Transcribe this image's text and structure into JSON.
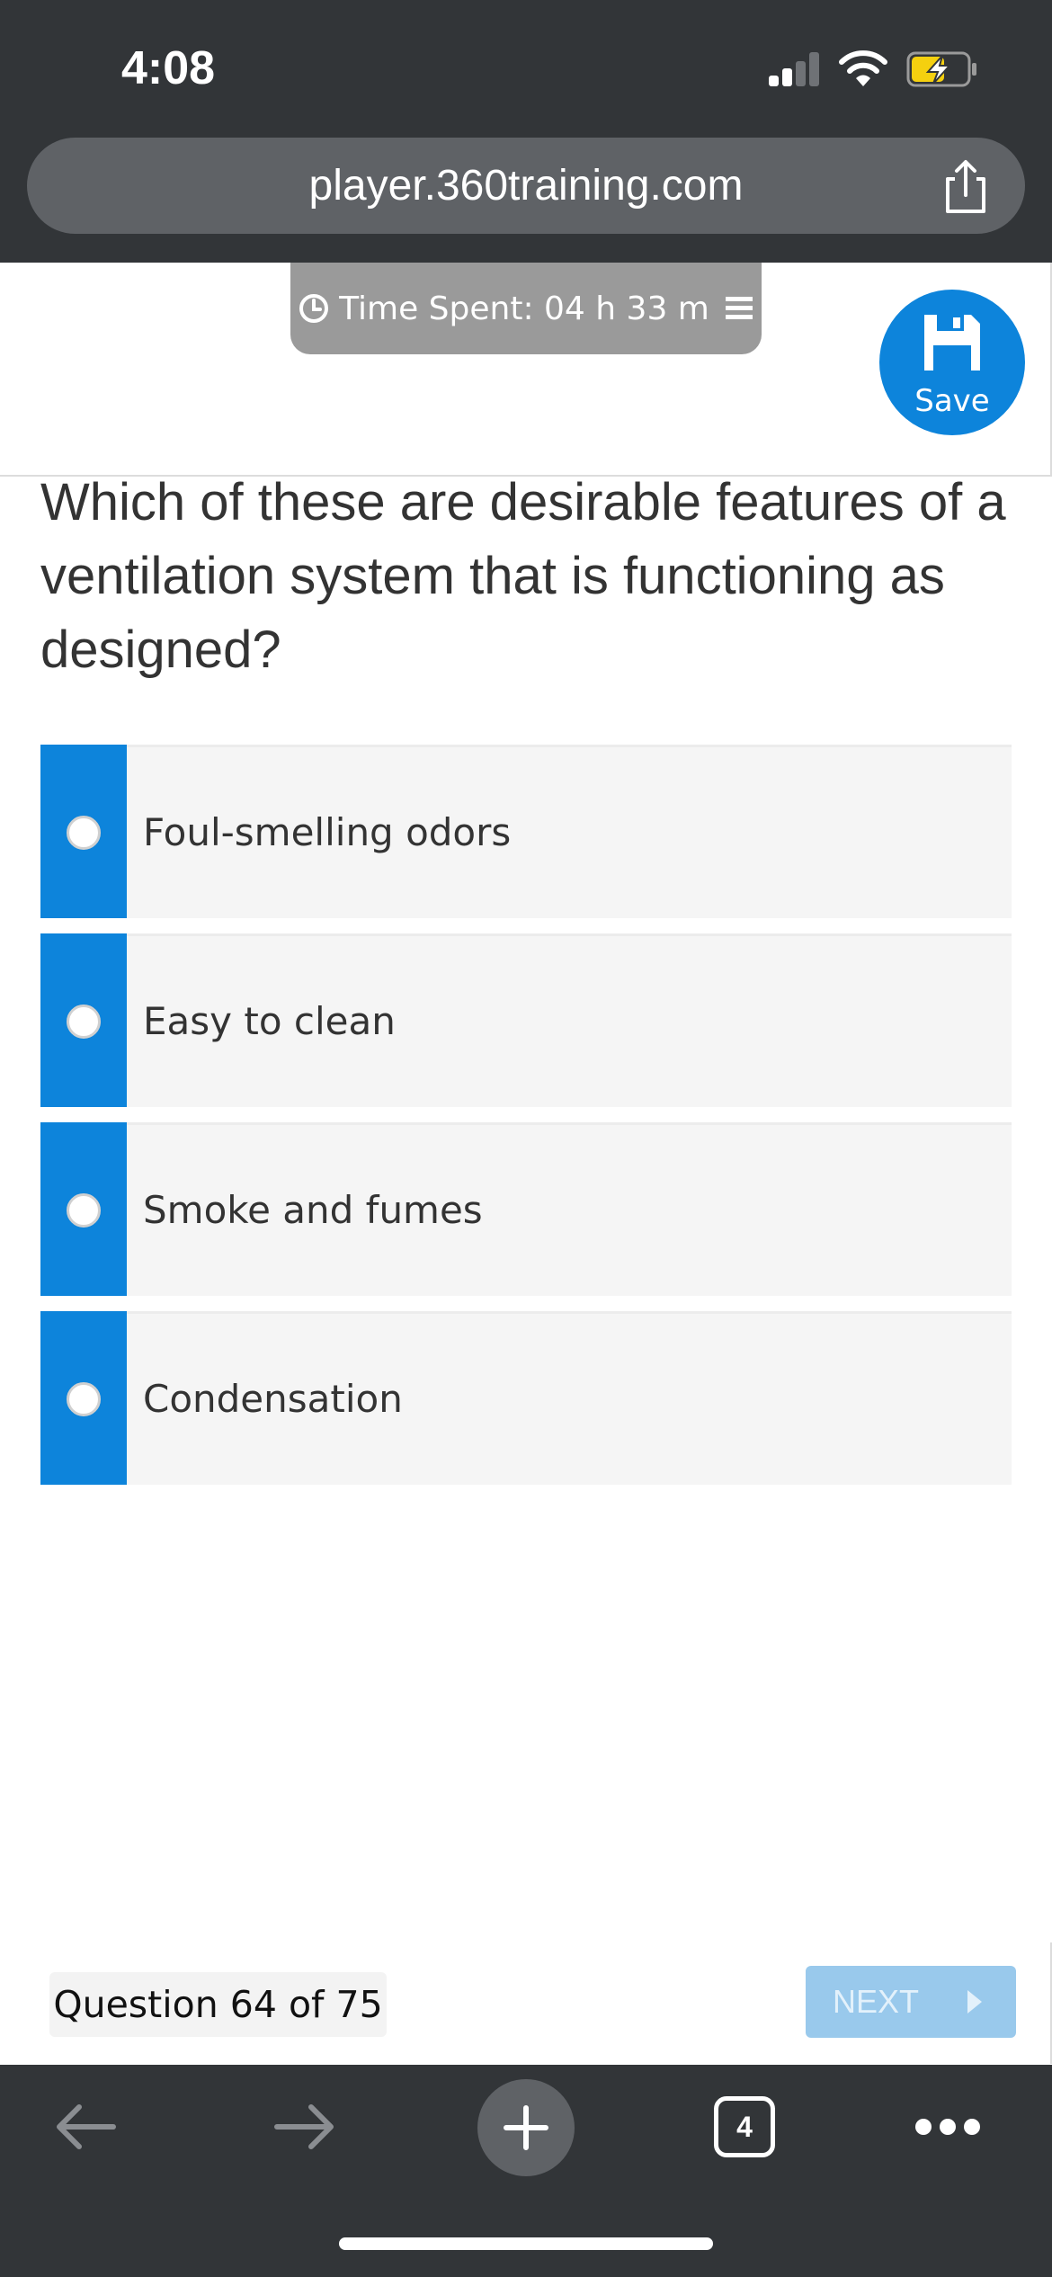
{
  "status_bar": {
    "time": "4:08",
    "signal_icon": "cellular-signal-icon",
    "wifi_icon": "wifi-icon",
    "battery_icon": "battery-charging-icon"
  },
  "browser": {
    "url": "player.360training.com",
    "share_icon": "share-icon"
  },
  "header": {
    "time_spent": "Time Spent: 04 h 33 m",
    "clock_icon": "clock-icon",
    "menu_icon": "hamburger-menu-icon",
    "save_label": "Save",
    "save_icon": "floppy-disk-icon",
    "accent_color": "#0d84db"
  },
  "question": {
    "text": "Which of these are desirable features of a ventilation system that is functioning as designed?",
    "options": [
      {
        "label": "Foul-smelling odors"
      },
      {
        "label": "Easy to clean"
      },
      {
        "label": "Smoke and fumes"
      },
      {
        "label": "Condensation"
      }
    ]
  },
  "footer": {
    "counter": "Question 64 of 75",
    "next_label": "NEXT",
    "next_color": "#99c9ec"
  },
  "toolbar": {
    "tab_count": "4",
    "back_icon": "arrow-left-icon",
    "forward_icon": "arrow-right-icon",
    "new_tab_icon": "plus-icon",
    "tabs_icon": "tabs-icon",
    "more_icon": "more-dots-icon"
  }
}
